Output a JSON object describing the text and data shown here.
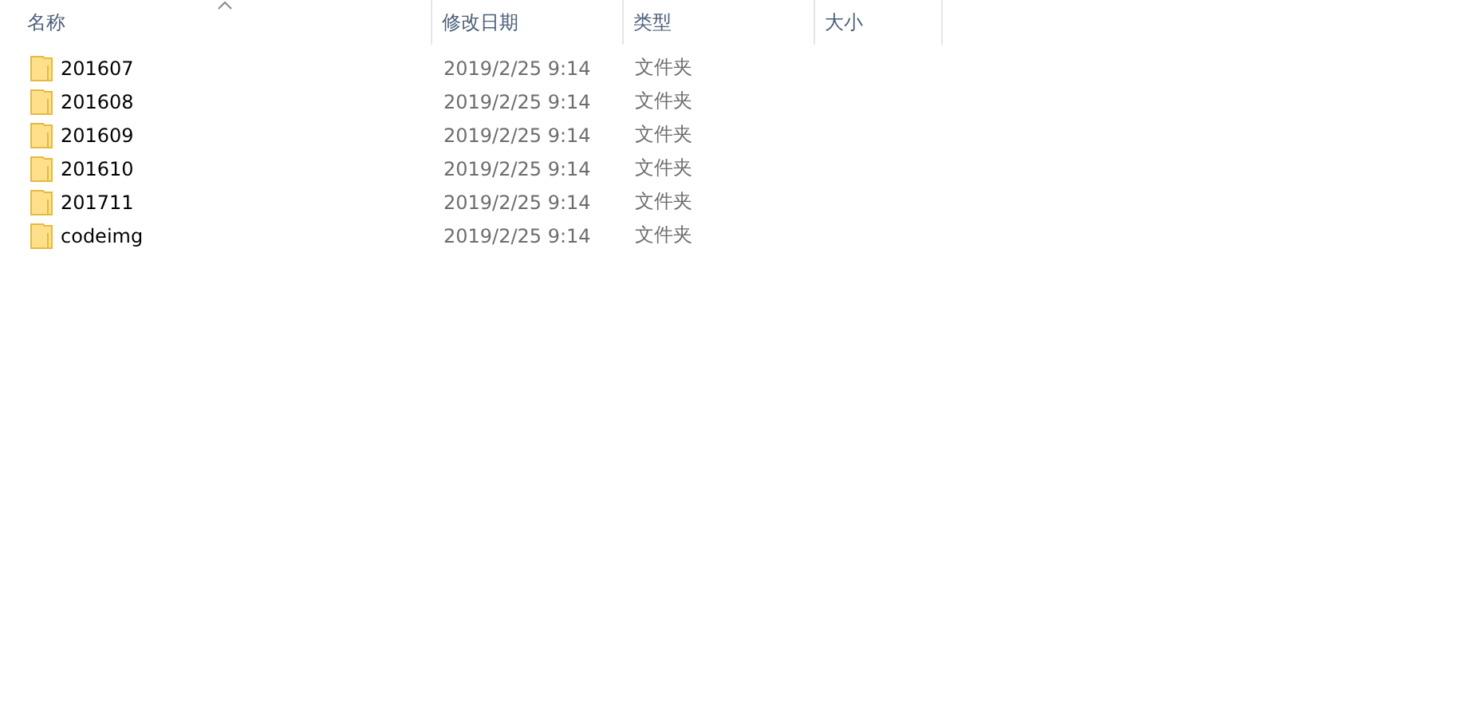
{
  "table": {
    "columns": [
      {
        "label": "名称",
        "sorted": true
      },
      {
        "label": "修改日期",
        "sorted": false
      },
      {
        "label": "类型",
        "sorted": false
      },
      {
        "label": "大小",
        "sorted": false
      }
    ],
    "rows": [
      {
        "name": "201607",
        "modified": "2019/2/25 9:14",
        "type": "文件夹"
      },
      {
        "name": "201608",
        "modified": "2019/2/25 9:14",
        "type": "文件夹"
      },
      {
        "name": "201609",
        "modified": "2019/2/25 9:14",
        "type": "文件夹"
      },
      {
        "name": "201610",
        "modified": "2019/2/25 9:14",
        "type": "文件夹"
      },
      {
        "name": "201711",
        "modified": "2019/2/25 9:14",
        "type": "文件夹"
      },
      {
        "name": "codeimg",
        "modified": "2019/2/25 9:14",
        "type": "文件夹"
      }
    ]
  }
}
